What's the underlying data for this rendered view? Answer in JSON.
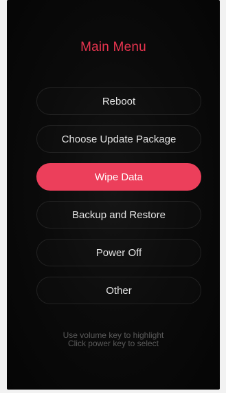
{
  "title": "Main Menu",
  "menu": [
    {
      "label": "Reboot",
      "active": false
    },
    {
      "label": "Choose Update Package",
      "active": false
    },
    {
      "label": "Wipe Data",
      "active": true
    },
    {
      "label": "Backup and Restore",
      "active": false
    },
    {
      "label": "Power Off",
      "active": false
    },
    {
      "label": "Other",
      "active": false
    }
  ],
  "hint": {
    "line1": "Use volume key to highlight",
    "line2": "Click power key to select"
  },
  "colors": {
    "accent": "#ec3f5b",
    "title": "#e8344f",
    "background": "#0b0b0b"
  }
}
